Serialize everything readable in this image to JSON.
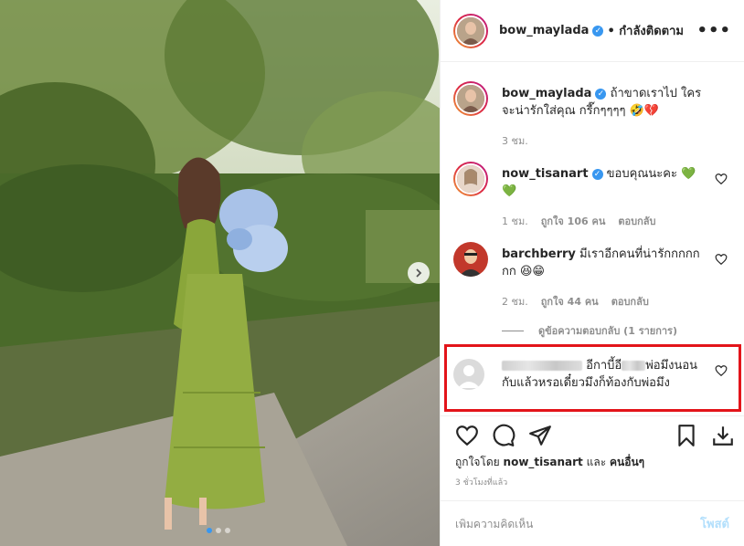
{
  "post": {
    "username": "bow_maylada",
    "follow_state": "• กำลังติดตาม",
    "more_label": "•••"
  },
  "caption": {
    "username": "bow_maylada",
    "text": "ถ้าขาดเราไป ใครจะน่ารักใส่คุณ กรี๊กๆๆๆๆ 🤣💔",
    "time": "3 ชม."
  },
  "comments": [
    {
      "username": "now_tisanart",
      "verified": true,
      "text": "ขอบคุณนะคะ 💚💚",
      "time": "1 ชม.",
      "likes": "ถูกใจ 106 คน",
      "reply": "ตอบกลับ"
    },
    {
      "username": "barchberry",
      "verified": false,
      "text": "มีเราอีกคนที่น่ารักกกกกกก 😆😁",
      "time": "2 ชม.",
      "likes": "ถูกใจ 44 คน",
      "reply": "ตอบกลับ"
    }
  ],
  "view_replies": "ดูข้อความตอบกลับ (1 รายการ)",
  "highlighted_comment": {
    "text_part1": "อีกาบี้อี",
    "text_part2": "พ่อมึงนอนกับแล้วหรอเดี๋ยวมึงก็ท้องกับพ่อมึง"
  },
  "liked_by": {
    "prefix": "ถูกใจโดย",
    "user": "now_tisanart",
    "joiner": "และ",
    "others": "คนอื่นๆ"
  },
  "time_ago": "3 ชั่วโมงที่แล้ว",
  "add_comment": {
    "placeholder": "เพิ่มความคิดเห็น",
    "post_label": "โพสต์"
  },
  "colors": {
    "accent": "#3897f0",
    "highlight_border": "#e3141a",
    "dress": "#8aa63a"
  },
  "carousel": {
    "total": 3,
    "active": 1
  }
}
